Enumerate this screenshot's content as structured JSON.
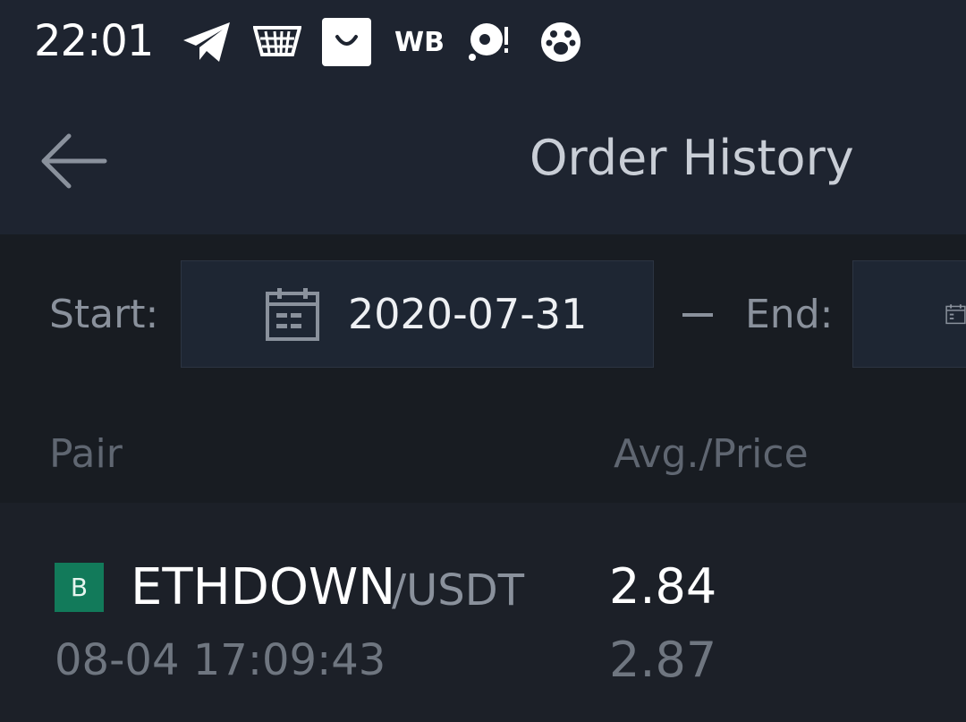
{
  "status_bar": {
    "time": "22:01",
    "wb_label": "WB",
    "icons": [
      "telegram-icon",
      "basket-icon",
      "shopping-bag-icon",
      "wb-icon",
      "chat-bubble-icon",
      "paw-icon"
    ]
  },
  "nav": {
    "title": "Order History",
    "back_icon": "arrow-left-icon"
  },
  "filter": {
    "start_label": "Start:",
    "start_date": "2020-07-31",
    "end_label": "End:",
    "end_date": "",
    "calendar_icon": "calendar-icon"
  },
  "columns": {
    "pair": "Pair",
    "avg_price": "Avg./Price"
  },
  "orders": [
    {
      "side_badge": "B",
      "base": "ETHDOWN",
      "quote": "/USDT",
      "time": "08-04 17:09:43",
      "avg": "2.84",
      "price": "2.87"
    }
  ],
  "colors": {
    "background": "#1e2430",
    "filter_background": "#181c22",
    "buy_badge": "#127a5a",
    "text_primary": "#ffffff",
    "text_secondary": "#8a919c"
  }
}
